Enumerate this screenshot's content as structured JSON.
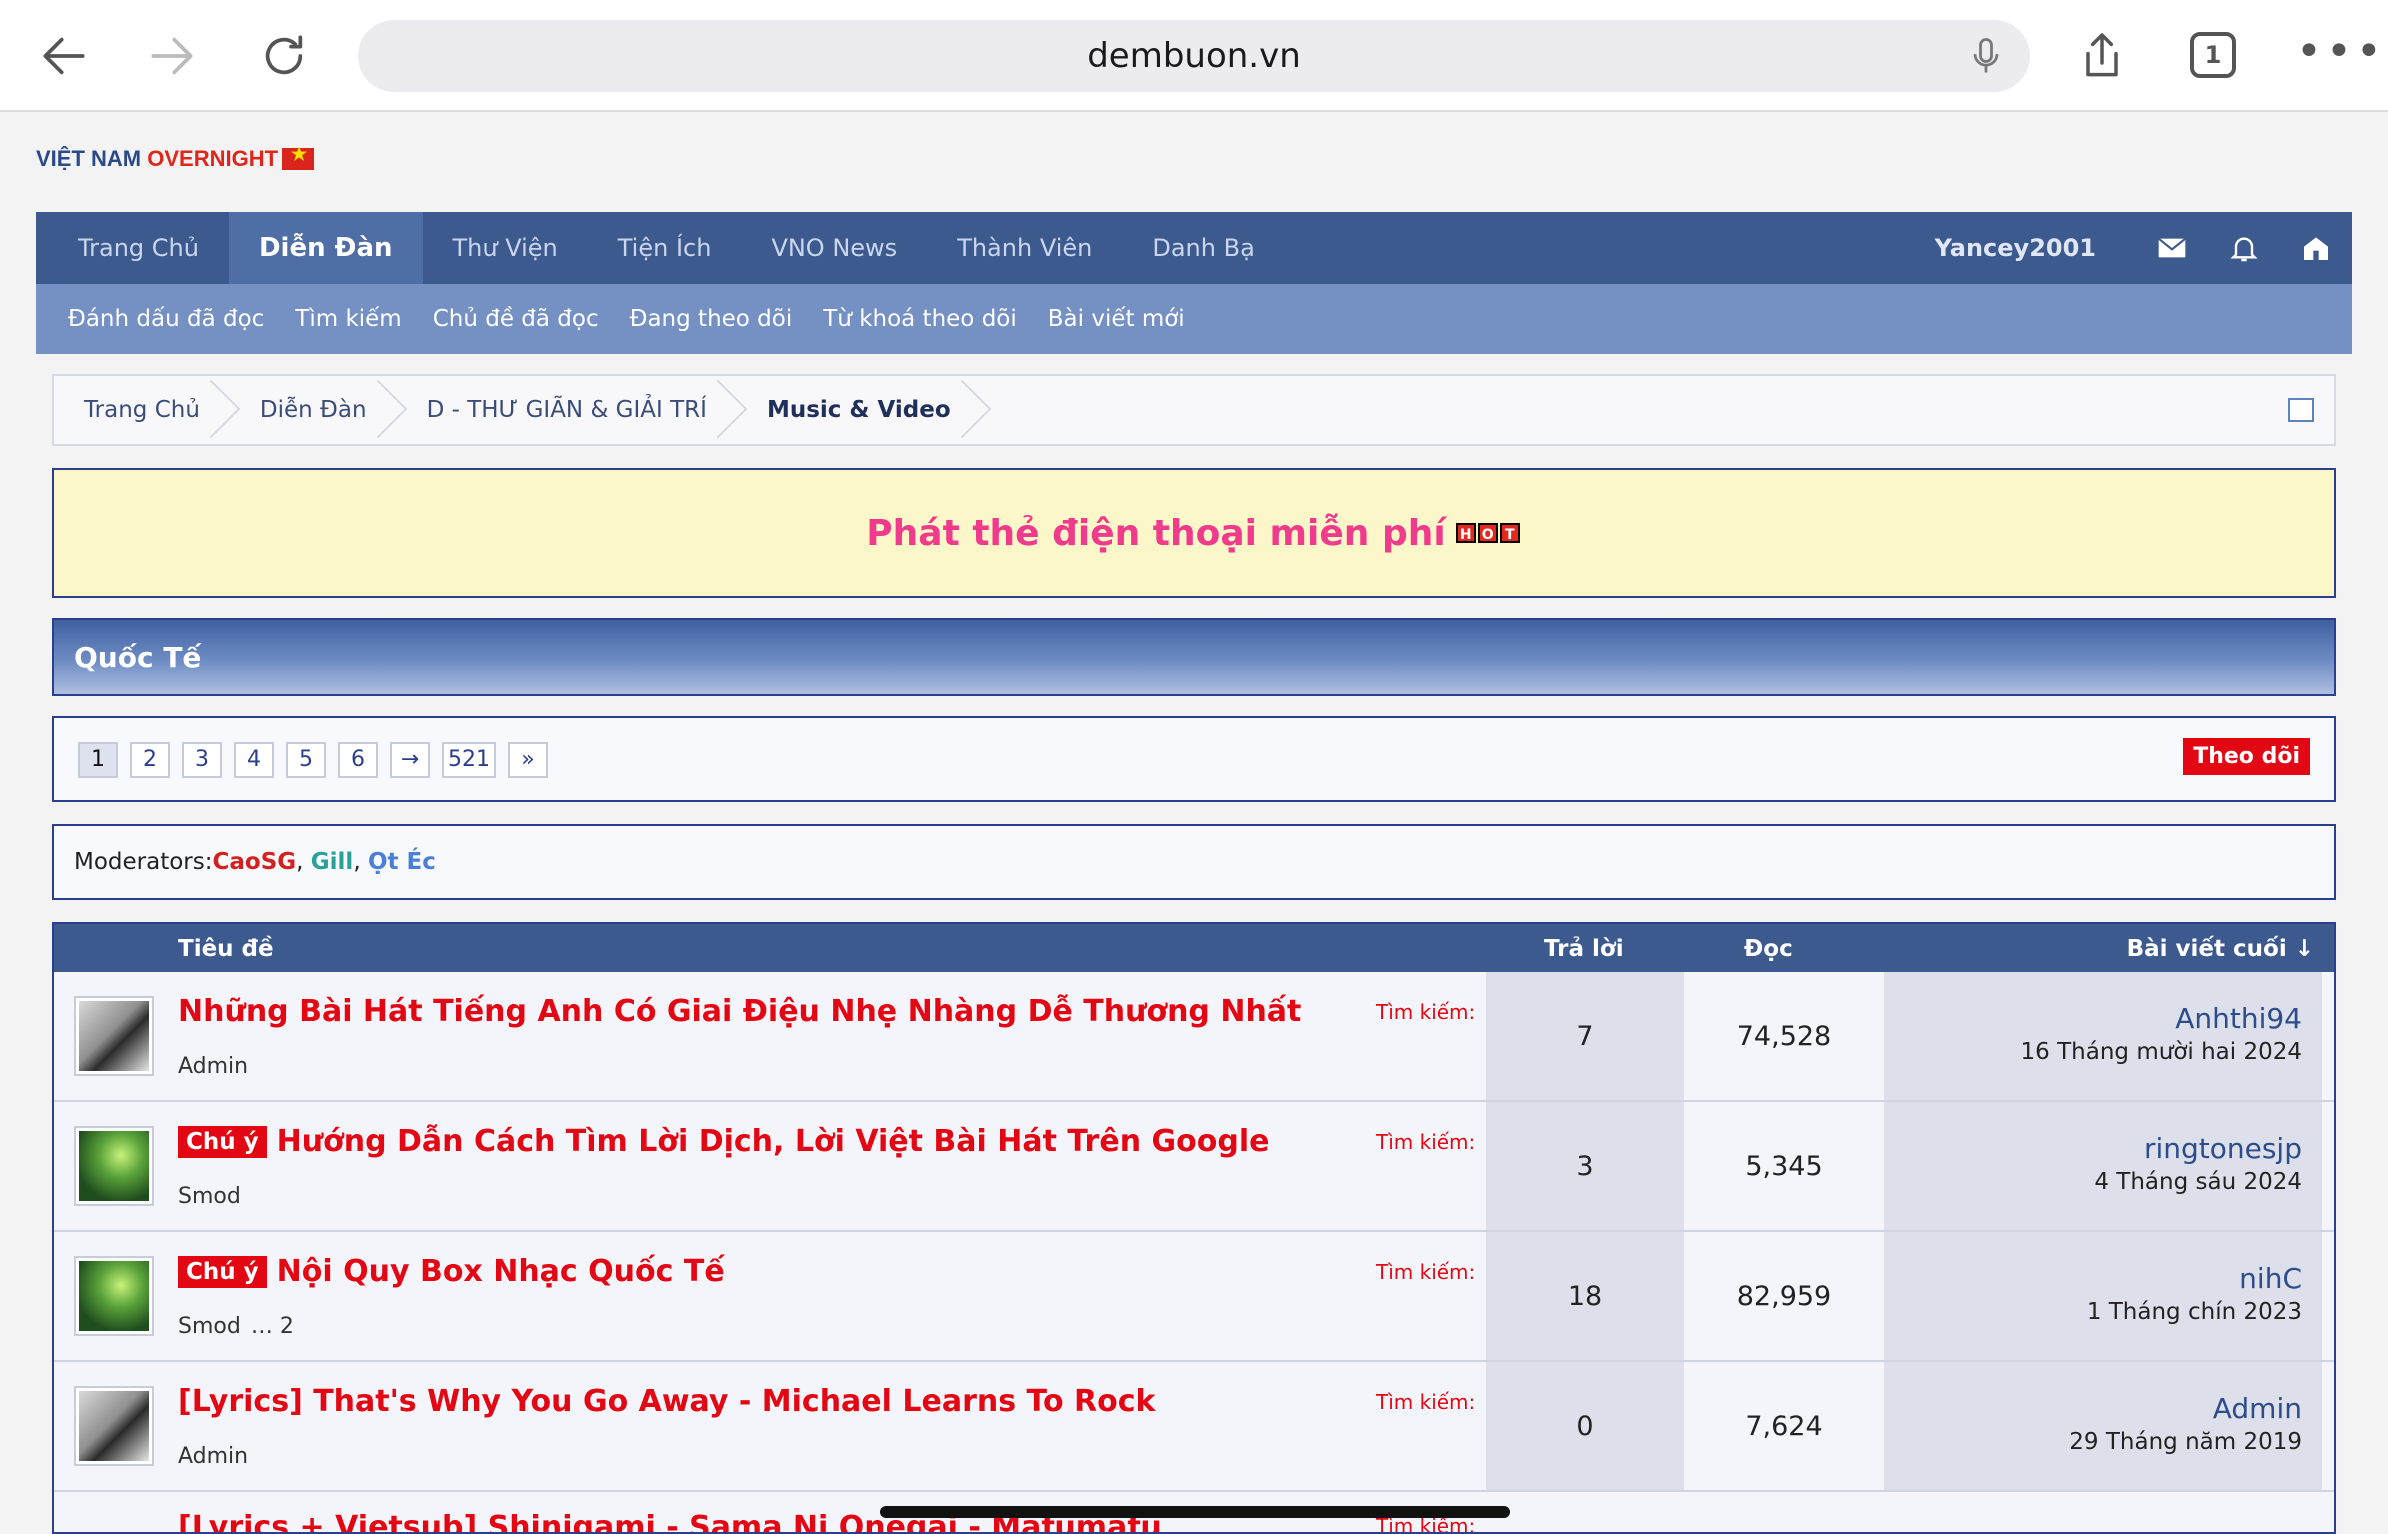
{
  "browser": {
    "url": "dembuon.vn",
    "tab_count": "1"
  },
  "logo": {
    "part1": "VIỆT NAM ",
    "part2": "OVERNIGHT"
  },
  "nav": {
    "tabs": [
      "Trang Chủ",
      "Diễn Đàn",
      "Thư Viện",
      "Tiện Ích",
      "VNO News",
      "Thành Viên",
      "Danh Bạ"
    ],
    "active_index": 1,
    "username": "Yancey2001",
    "sub": [
      "Đánh dấu đã đọc",
      "Tìm kiếm",
      "Chủ đề đã đọc",
      "Đang theo dõi",
      "Từ khoá theo dõi",
      "Bài viết mới"
    ]
  },
  "breadcrumb": [
    "Trang Chủ",
    "Diễn Đàn",
    "D - THƯ GIÃN & GIẢI TRÍ",
    "Music & Video"
  ],
  "banner": {
    "text": "Phát thẻ điện thoại miễn phí",
    "hot": [
      "H",
      "O",
      "T"
    ]
  },
  "section_title": "Quốc Tế",
  "pager": {
    "pages": [
      "1",
      "2",
      "3",
      "4",
      "5",
      "6",
      "→",
      "521",
      "»"
    ],
    "active": "1",
    "follow": "Theo dõi"
  },
  "moderators": {
    "label": "Moderators: ",
    "names": [
      "CaoSG",
      "Gill",
      "Ọt Éc"
    ]
  },
  "table": {
    "headers": {
      "title": "Tiêu đề",
      "replies": "Trả lời",
      "views": "Đọc",
      "last": "Bài viết cuối ↓"
    },
    "search_label": "Tìm kiếm:",
    "rows": [
      {
        "tag": "",
        "title": "Những Bài Hát Tiếng Anh Có Giai Điệu Nhẹ Nhàng Dễ Thương Nhất",
        "author": "Admin",
        "pages": "",
        "replies": "7",
        "views": "74,528",
        "last_user": "Anhthi94",
        "last_date": "16 Tháng mười hai 2024"
      },
      {
        "tag": "Chú ý",
        "title": "Hướng Dẫn Cách Tìm Lời Dịch, Lời Việt Bài Hát Trên Google",
        "author": "Smod",
        "pages": "",
        "replies": "3",
        "views": "5,345",
        "last_user": "ringtonesjp",
        "last_date": "4 Tháng sáu 2024"
      },
      {
        "tag": "Chú ý",
        "title": "Nội Quy Box Nhạc Quốc Tế",
        "author": "Smod",
        "pages": "…  2",
        "replies": "18",
        "views": "82,959",
        "last_user": "nihC",
        "last_date": "1 Tháng chín 2023"
      },
      {
        "tag": "",
        "title": "[Lyrics] That's Why You Go Away - Michael Learns To Rock",
        "author": "Admin",
        "pages": "",
        "replies": "0",
        "views": "7,624",
        "last_user": "Admin",
        "last_date": "29 Tháng năm 2019"
      }
    ],
    "partial_title": "[Lyrics + Vietsub] Shinigami - Sama Ni Onegai - Mafumafu"
  }
}
